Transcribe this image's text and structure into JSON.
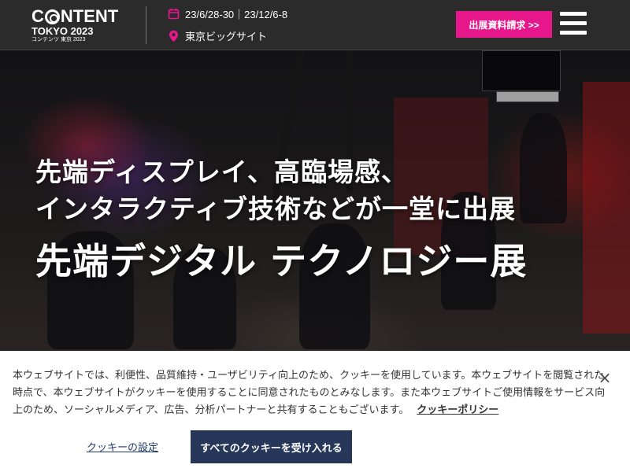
{
  "header": {
    "logo": {
      "word_pre": "C",
      "word_post": "NTENT",
      "line2": "TOKYO 2023",
      "line3": "コンテンツ 東京 2023"
    },
    "dates": "23/6/28-30｜23/12/6-8",
    "venue": "東京ビッグサイト",
    "cta_label": "出展資料請求 >>",
    "colors": {
      "accent": "#e6168b",
      "icon": "#e6168b"
    },
    "icons": {
      "dates": "calendar-icon",
      "venue": "map-pin-icon",
      "menu": "hamburger-menu-icon"
    }
  },
  "hero": {
    "line1": "先端ディスプレイ、高臨場感、",
    "line2": "インタラクティブ技術などが一堂に出展",
    "title": "先端デジタル テクノロジー展"
  },
  "cookie_banner": {
    "message": "本ウェブサイトでは、利便性、品質維持・ユーザビリティ向上のため、クッキーを使用しています。本ウェブサイトを閲覧された時点で、本ウェブサイトがクッキーを使用することに同意されたものとみなします。また本ウェブサイトご使用情報をサービス向上のため、ソーシャルメディア、広告、分析パートナーと共有することもございます。",
    "policy_link": "クッキーポリシー",
    "close_symbol": "×",
    "settings_label": "クッキーの設定",
    "accept_label": "すべてのクッキーを受け入れる",
    "colors": {
      "primary_button": "#27375a",
      "link": "#1e3a6e"
    }
  }
}
